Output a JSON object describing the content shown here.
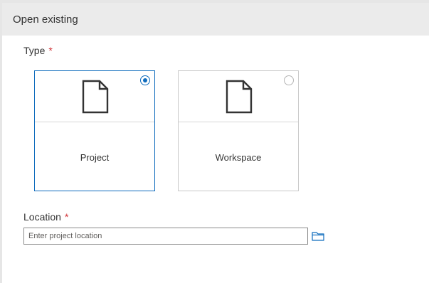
{
  "dialog": {
    "title": "Open existing"
  },
  "type_field": {
    "label": "Type",
    "required_marker": "*",
    "options": [
      {
        "label": "Project",
        "icon": "document-icon",
        "selected": true
      },
      {
        "label": "Workspace",
        "icon": "document-icon",
        "selected": false
      }
    ]
  },
  "location_field": {
    "label": "Location",
    "required_marker": "*",
    "value": "",
    "placeholder": "Enter project location",
    "browse_icon": "folder-icon"
  },
  "colors": {
    "accent": "#0f6cbd",
    "required": "#d13438",
    "header_bg": "#ebebeb"
  }
}
